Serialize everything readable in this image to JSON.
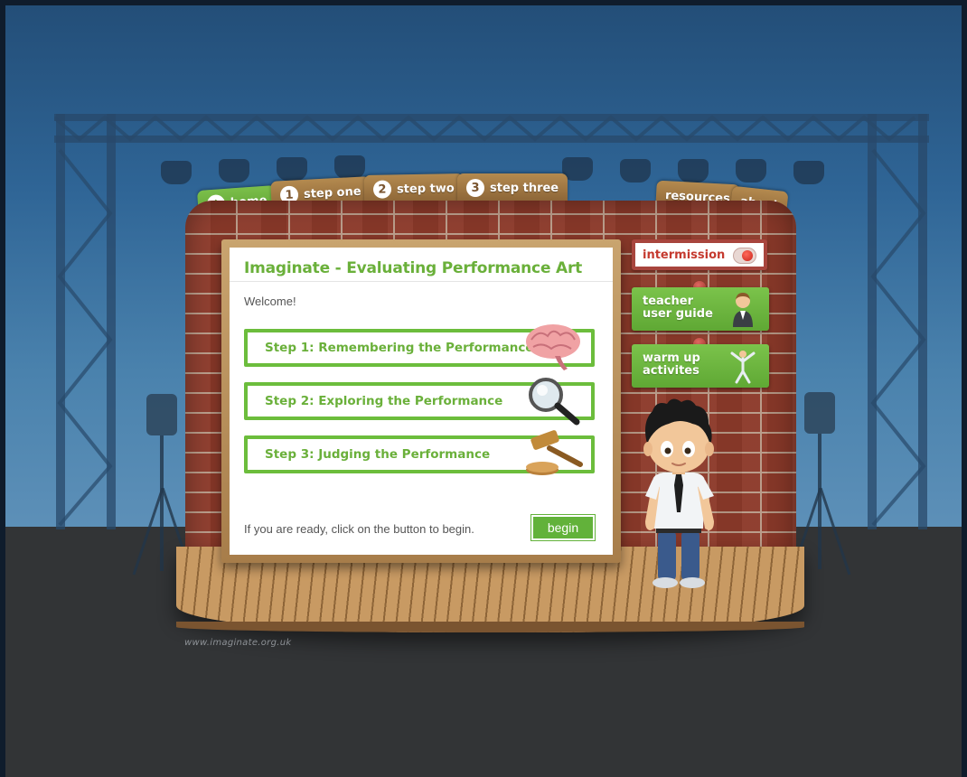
{
  "nav": {
    "home": "home",
    "step_one": {
      "num": "1",
      "label": "step one"
    },
    "step_two": {
      "num": "2",
      "label": "step two"
    },
    "step_three": {
      "num": "3",
      "label": "step three"
    },
    "resources": "resources",
    "about": "about"
  },
  "panel": {
    "title": "Imaginate - Evaluating Performance Art",
    "welcome": "Welcome!",
    "steps": [
      {
        "label": "Step 1: Remembering the Performance",
        "icon": "brain-icon"
      },
      {
        "label": "Step 2: Exploring the Performance",
        "icon": "magnifying-glass-icon"
      },
      {
        "label": "Step 3: Judging the Performance",
        "icon": "gavel-icon"
      }
    ],
    "ready_text": "If you are ready, click on the button to begin.",
    "begin_label": "begin"
  },
  "side": {
    "intermission": "intermission",
    "teacher_guide": [
      "teacher",
      "user guide"
    ],
    "warm_up": [
      "warm up",
      "activites"
    ]
  },
  "footer": {
    "url": "www.imaginate.org.uk"
  },
  "colors": {
    "accent_green": "#6ab03a",
    "tab_brown": "#8b6436",
    "intermission_red": "#c53a2f"
  }
}
